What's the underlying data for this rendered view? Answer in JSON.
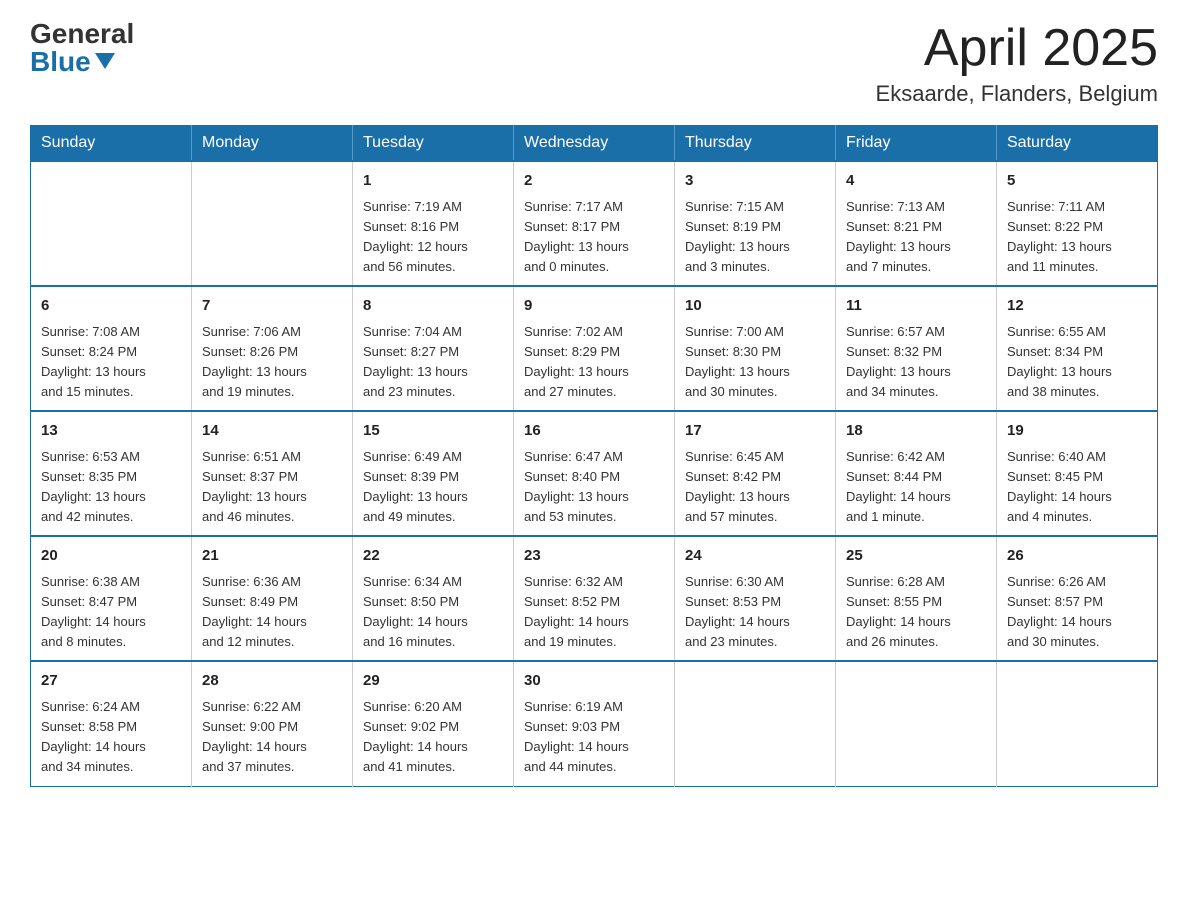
{
  "header": {
    "logo_general": "General",
    "logo_blue": "Blue",
    "title": "April 2025",
    "subtitle": "Eksaarde, Flanders, Belgium"
  },
  "calendar": {
    "days_of_week": [
      "Sunday",
      "Monday",
      "Tuesday",
      "Wednesday",
      "Thursday",
      "Friday",
      "Saturday"
    ],
    "weeks": [
      [
        {
          "day": "",
          "info": ""
        },
        {
          "day": "",
          "info": ""
        },
        {
          "day": "1",
          "info": "Sunrise: 7:19 AM\nSunset: 8:16 PM\nDaylight: 12 hours\nand 56 minutes."
        },
        {
          "day": "2",
          "info": "Sunrise: 7:17 AM\nSunset: 8:17 PM\nDaylight: 13 hours\nand 0 minutes."
        },
        {
          "day": "3",
          "info": "Sunrise: 7:15 AM\nSunset: 8:19 PM\nDaylight: 13 hours\nand 3 minutes."
        },
        {
          "day": "4",
          "info": "Sunrise: 7:13 AM\nSunset: 8:21 PM\nDaylight: 13 hours\nand 7 minutes."
        },
        {
          "day": "5",
          "info": "Sunrise: 7:11 AM\nSunset: 8:22 PM\nDaylight: 13 hours\nand 11 minutes."
        }
      ],
      [
        {
          "day": "6",
          "info": "Sunrise: 7:08 AM\nSunset: 8:24 PM\nDaylight: 13 hours\nand 15 minutes."
        },
        {
          "day": "7",
          "info": "Sunrise: 7:06 AM\nSunset: 8:26 PM\nDaylight: 13 hours\nand 19 minutes."
        },
        {
          "day": "8",
          "info": "Sunrise: 7:04 AM\nSunset: 8:27 PM\nDaylight: 13 hours\nand 23 minutes."
        },
        {
          "day": "9",
          "info": "Sunrise: 7:02 AM\nSunset: 8:29 PM\nDaylight: 13 hours\nand 27 minutes."
        },
        {
          "day": "10",
          "info": "Sunrise: 7:00 AM\nSunset: 8:30 PM\nDaylight: 13 hours\nand 30 minutes."
        },
        {
          "day": "11",
          "info": "Sunrise: 6:57 AM\nSunset: 8:32 PM\nDaylight: 13 hours\nand 34 minutes."
        },
        {
          "day": "12",
          "info": "Sunrise: 6:55 AM\nSunset: 8:34 PM\nDaylight: 13 hours\nand 38 minutes."
        }
      ],
      [
        {
          "day": "13",
          "info": "Sunrise: 6:53 AM\nSunset: 8:35 PM\nDaylight: 13 hours\nand 42 minutes."
        },
        {
          "day": "14",
          "info": "Sunrise: 6:51 AM\nSunset: 8:37 PM\nDaylight: 13 hours\nand 46 minutes."
        },
        {
          "day": "15",
          "info": "Sunrise: 6:49 AM\nSunset: 8:39 PM\nDaylight: 13 hours\nand 49 minutes."
        },
        {
          "day": "16",
          "info": "Sunrise: 6:47 AM\nSunset: 8:40 PM\nDaylight: 13 hours\nand 53 minutes."
        },
        {
          "day": "17",
          "info": "Sunrise: 6:45 AM\nSunset: 8:42 PM\nDaylight: 13 hours\nand 57 minutes."
        },
        {
          "day": "18",
          "info": "Sunrise: 6:42 AM\nSunset: 8:44 PM\nDaylight: 14 hours\nand 1 minute."
        },
        {
          "day": "19",
          "info": "Sunrise: 6:40 AM\nSunset: 8:45 PM\nDaylight: 14 hours\nand 4 minutes."
        }
      ],
      [
        {
          "day": "20",
          "info": "Sunrise: 6:38 AM\nSunset: 8:47 PM\nDaylight: 14 hours\nand 8 minutes."
        },
        {
          "day": "21",
          "info": "Sunrise: 6:36 AM\nSunset: 8:49 PM\nDaylight: 14 hours\nand 12 minutes."
        },
        {
          "day": "22",
          "info": "Sunrise: 6:34 AM\nSunset: 8:50 PM\nDaylight: 14 hours\nand 16 minutes."
        },
        {
          "day": "23",
          "info": "Sunrise: 6:32 AM\nSunset: 8:52 PM\nDaylight: 14 hours\nand 19 minutes."
        },
        {
          "day": "24",
          "info": "Sunrise: 6:30 AM\nSunset: 8:53 PM\nDaylight: 14 hours\nand 23 minutes."
        },
        {
          "day": "25",
          "info": "Sunrise: 6:28 AM\nSunset: 8:55 PM\nDaylight: 14 hours\nand 26 minutes."
        },
        {
          "day": "26",
          "info": "Sunrise: 6:26 AM\nSunset: 8:57 PM\nDaylight: 14 hours\nand 30 minutes."
        }
      ],
      [
        {
          "day": "27",
          "info": "Sunrise: 6:24 AM\nSunset: 8:58 PM\nDaylight: 14 hours\nand 34 minutes."
        },
        {
          "day": "28",
          "info": "Sunrise: 6:22 AM\nSunset: 9:00 PM\nDaylight: 14 hours\nand 37 minutes."
        },
        {
          "day": "29",
          "info": "Sunrise: 6:20 AM\nSunset: 9:02 PM\nDaylight: 14 hours\nand 41 minutes."
        },
        {
          "day": "30",
          "info": "Sunrise: 6:19 AM\nSunset: 9:03 PM\nDaylight: 14 hours\nand 44 minutes."
        },
        {
          "day": "",
          "info": ""
        },
        {
          "day": "",
          "info": ""
        },
        {
          "day": "",
          "info": ""
        }
      ]
    ]
  }
}
